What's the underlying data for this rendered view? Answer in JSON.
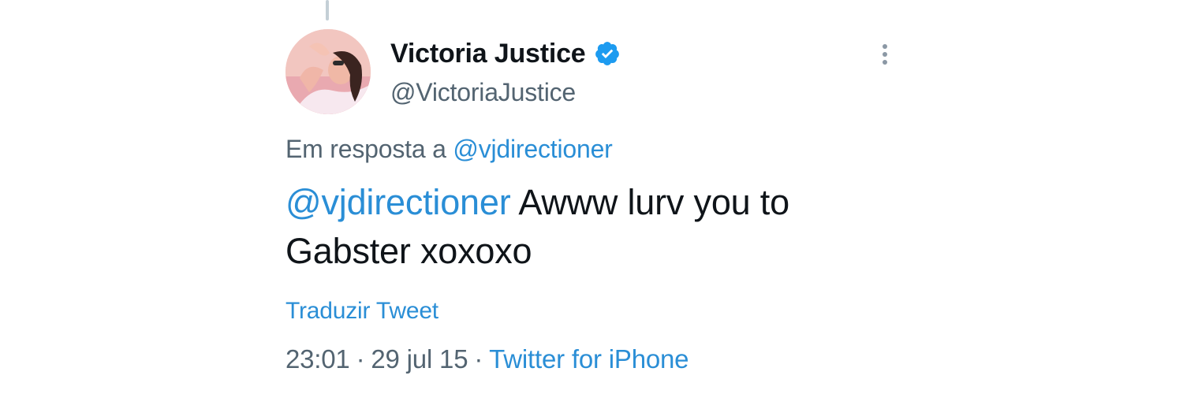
{
  "author": {
    "display_name": "Victoria Justice",
    "handle": "@VictoriaJustice",
    "verified": true,
    "avatar_icon": "profile-photo"
  },
  "reply_context": {
    "prefix": "Em resposta a",
    "mention": "@vjdirectioner"
  },
  "tweet": {
    "mention": "@vjdirectioner",
    "body": "Awww lurv you to Gabster xoxoxo"
  },
  "translate_label": "Traduzir Tweet",
  "meta": {
    "time": "23:01",
    "date": "29 jul 15",
    "separator": "·",
    "source": "Twitter for iPhone"
  },
  "colors": {
    "accent": "#1d9bf0",
    "link": "#2a8ed6",
    "text_primary": "#0f1419",
    "text_secondary": "#536471"
  },
  "icons": {
    "verified": "verified-badge-icon",
    "more": "more-vertical-icon"
  }
}
